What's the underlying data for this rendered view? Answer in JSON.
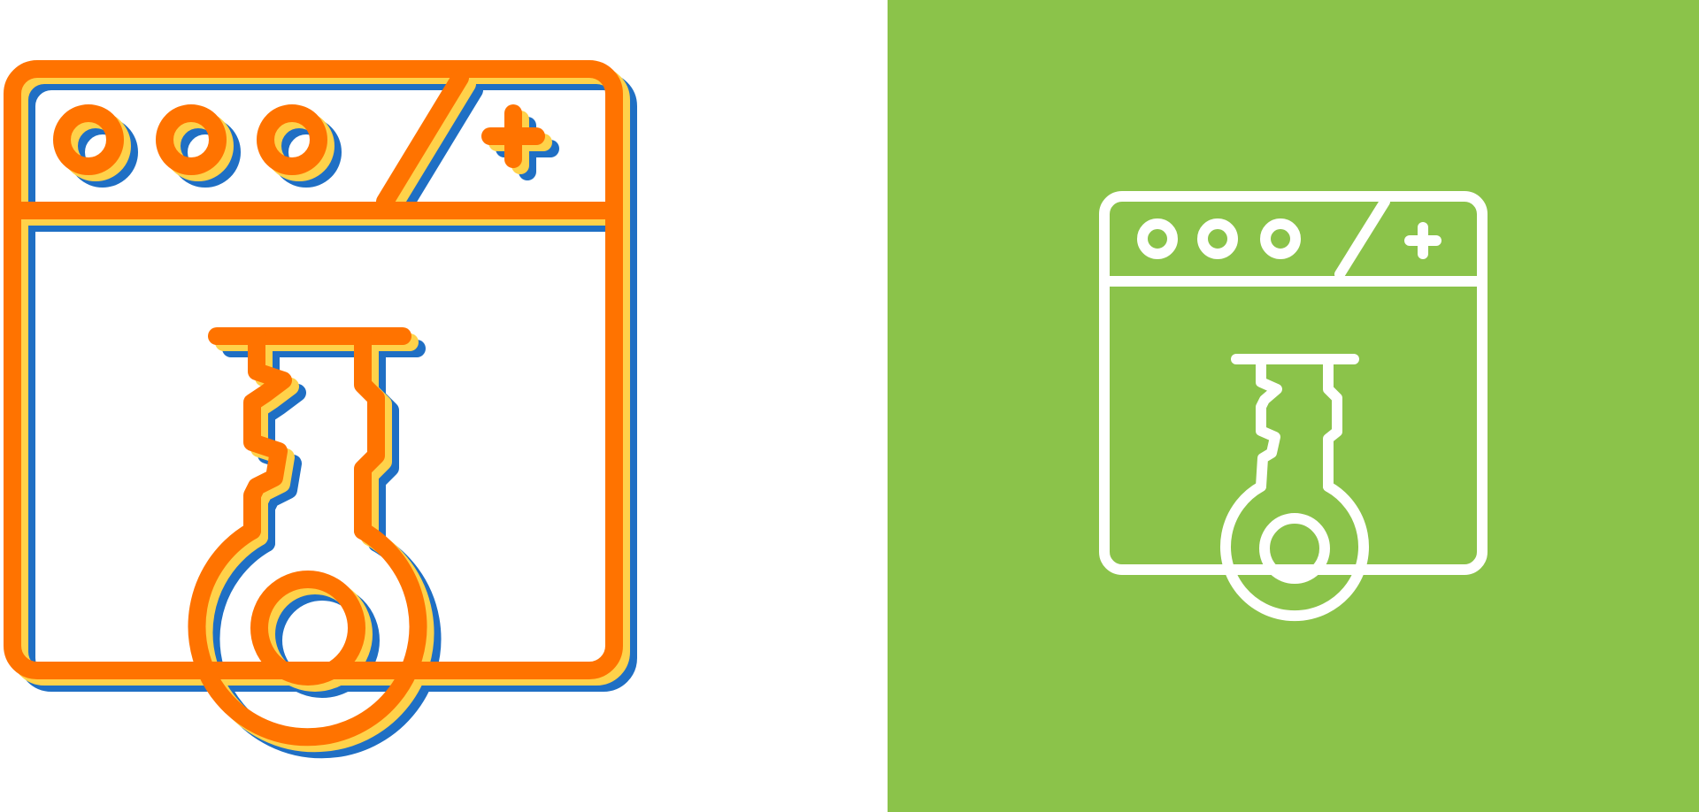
{
  "colors": {
    "left_background": "#ffffff",
    "right_background": "#8bc34a",
    "primary_orange": "#ff7300",
    "shadow_yellow": "#ffd24a",
    "shadow_blue": "#1f6fc4",
    "line_white": "#ffffff"
  },
  "icons": {
    "left": "browser-key-icon",
    "right": "browser-key-line-icon"
  }
}
